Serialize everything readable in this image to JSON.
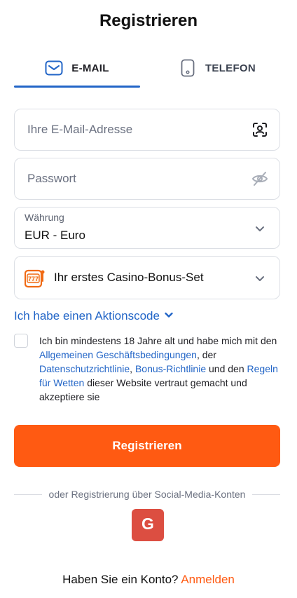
{
  "title": "Registrieren",
  "tabs": [
    {
      "label": "E-MAIL",
      "icon": "envelope-icon",
      "active": true
    },
    {
      "label": "TELEFON",
      "icon": "phone-icon",
      "active": false
    }
  ],
  "email_field": {
    "placeholder": "Ihre E-Mail-Adresse",
    "value": "",
    "icon": "user-scan-icon"
  },
  "password_field": {
    "placeholder": "Passwort",
    "value": "",
    "icon": "eye-off-icon"
  },
  "currency": {
    "caption": "Währung",
    "value": "EUR - Euro"
  },
  "bonus": {
    "label": "Ihr erstes Casino-Bonus-Set",
    "icon": "slot-777-icon"
  },
  "promo_code": {
    "label": "Ich habe einen Aktionscode"
  },
  "consent": {
    "text_1": "Ich bin mindestens 18 Jahre alt und habe mich mit den ",
    "link_terms": "Allgemeinen Geschäftsbedingungen",
    "text_2": ", der ",
    "link_privacy": "Datenschutzrichtlinie",
    "text_3": ", ",
    "link_bonus": "Bonus-Richtlinie",
    "text_4": " und den ",
    "link_betting": "Regeln für Wetten",
    "text_5": " dieser Website vertraut gemacht und akzeptiere sie",
    "checked": false
  },
  "register_button": {
    "label": "Registrieren"
  },
  "social": {
    "divider_text": "oder Registrierung über Social-Media-Konten",
    "google_letter": "G"
  },
  "footer": {
    "text": "Haben Sie ein Konto?",
    "link": "Anmelden"
  },
  "colors": {
    "accent": "#ff5a12",
    "link": "#2265c7",
    "google": "#dc4e41"
  }
}
